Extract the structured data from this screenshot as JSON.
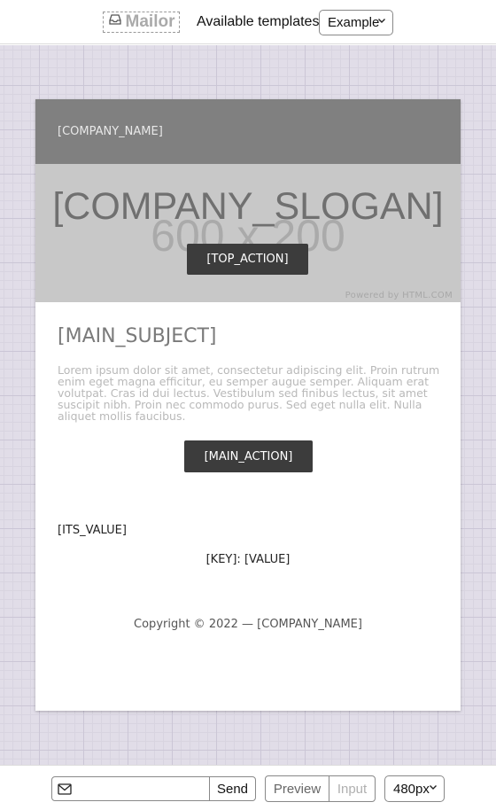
{
  "toolbar": {
    "logo_text": "Mailor",
    "templates_label": "Available templates:",
    "template_selected": "Example"
  },
  "email": {
    "header_company": "[COMPANY_NAME]",
    "hero_placeholder": "600 x 200",
    "hero_slogan": "[COMPANY_SLOGAN]",
    "hero_button": "[TOP_ACTION]",
    "powered_by": "Powered by HTML.COM",
    "subject": "[MAIN_SUBJECT]",
    "body_text": "Lorem ipsum dolor sit amet, consectetur adipiscing elit. Proin rutrum enim eget magna efficitur, eu semper augue semper. Aliquam erat volutpat. Cras id dui lectus. Vestibulum sed finibus lectus, sit amet suscipit nibh. Proin nec commodo purus. Sed eget nulla elit. Nulla aliquet mollis faucibus.",
    "main_button": "[MAIN_ACTION]",
    "its_value": "[ITS_VALUE]",
    "key_value": "[KEY]: [VALUE]",
    "copyright": "Copyright © 2022 — [COMPANY_NAME]"
  },
  "bottombar": {
    "send_placeholder": "",
    "send_label": "Send",
    "preview_label": "Preview",
    "input_label": "Input",
    "size_selected": "480px"
  },
  "colors": {
    "canvas_bg": "#e1dde8",
    "header_bg": "#808080",
    "hero_bg": "#c8c8c8",
    "button_bg": "#3c3c3c"
  },
  "icons": {
    "logo": "inbox-icon",
    "send_field": "envelope-icon",
    "select_arrow": "chevron-down-icon"
  }
}
